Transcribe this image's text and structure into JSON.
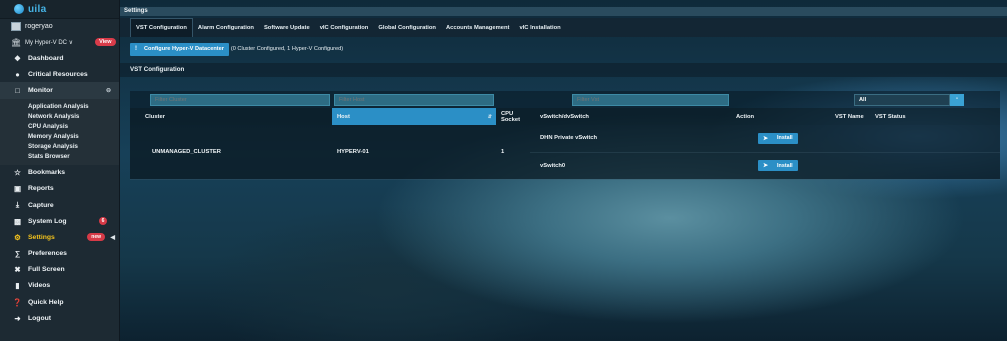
{
  "app": {
    "logo_text": "uila",
    "accent": "#2b8fc6",
    "active_color": "#f3c21c"
  },
  "user": {
    "name": "rogeryao"
  },
  "datacenter": {
    "label": "My Hyper-V DC ∨",
    "view_button": "View"
  },
  "sidebar": {
    "items": [
      {
        "label": "Dashboard",
        "icon": "home-icon"
      },
      {
        "label": "Critical Resources",
        "icon": "pin-icon"
      },
      {
        "label": "Monitor",
        "icon": "monitor-icon",
        "chevron": "⊖"
      }
    ],
    "monitor_sub": [
      "Application Analysis",
      "Network Analysis",
      "CPU Analysis",
      "Memory Analysis",
      "Storage Analysis",
      "Stats Browser"
    ],
    "lower_items": [
      {
        "label": "Bookmarks",
        "icon": "star-icon"
      },
      {
        "label": "Reports",
        "icon": "report-icon"
      },
      {
        "label": "Capture",
        "icon": "download-icon"
      },
      {
        "label": "System Log",
        "icon": "log-icon",
        "badge": "6"
      },
      {
        "label": "Settings",
        "icon": "gear-icon",
        "badge": "new"
      },
      {
        "label": "Preferences",
        "icon": "sliders-icon"
      },
      {
        "label": "Full Screen",
        "icon": "fullscreen-icon"
      },
      {
        "label": "Videos",
        "icon": "video-icon"
      },
      {
        "label": "Quick Help",
        "icon": "help-icon"
      },
      {
        "label": "Logout",
        "icon": "logout-icon"
      }
    ]
  },
  "main": {
    "title": "Settings",
    "tabs": [
      "VST Configuration",
      "Alarm Configuration",
      "Software Update",
      "vIC Configuration",
      "Global Configuration",
      "Accounts Management",
      "vIC Installation"
    ],
    "configure_button": "Configure Hyper-V Datacenter",
    "configure_status": "(0 Cluster Configured, 1 Hyper-V Configured)",
    "section_title": "VST Configuration",
    "filters": {
      "cluster_placeholder": "Filter Cluster",
      "host_placeholder": "Filter Host",
      "vst_placeholder": "Filter Vst",
      "select_value": "All"
    },
    "columns": [
      "Cluster",
      "Host",
      "CPU Socket",
      "vSwitch/dvSwitch",
      "Action",
      "VST Name",
      "VST Status"
    ],
    "rows": [
      {
        "cluster": "UNMANAGED_CLUSTER",
        "host": "HYPERV-01",
        "cpu_socket": "1",
        "switches": [
          {
            "name": "DHN Private vSwitch",
            "action": "Install"
          },
          {
            "name": "vSwitch0",
            "action": "Install"
          }
        ]
      }
    ]
  }
}
